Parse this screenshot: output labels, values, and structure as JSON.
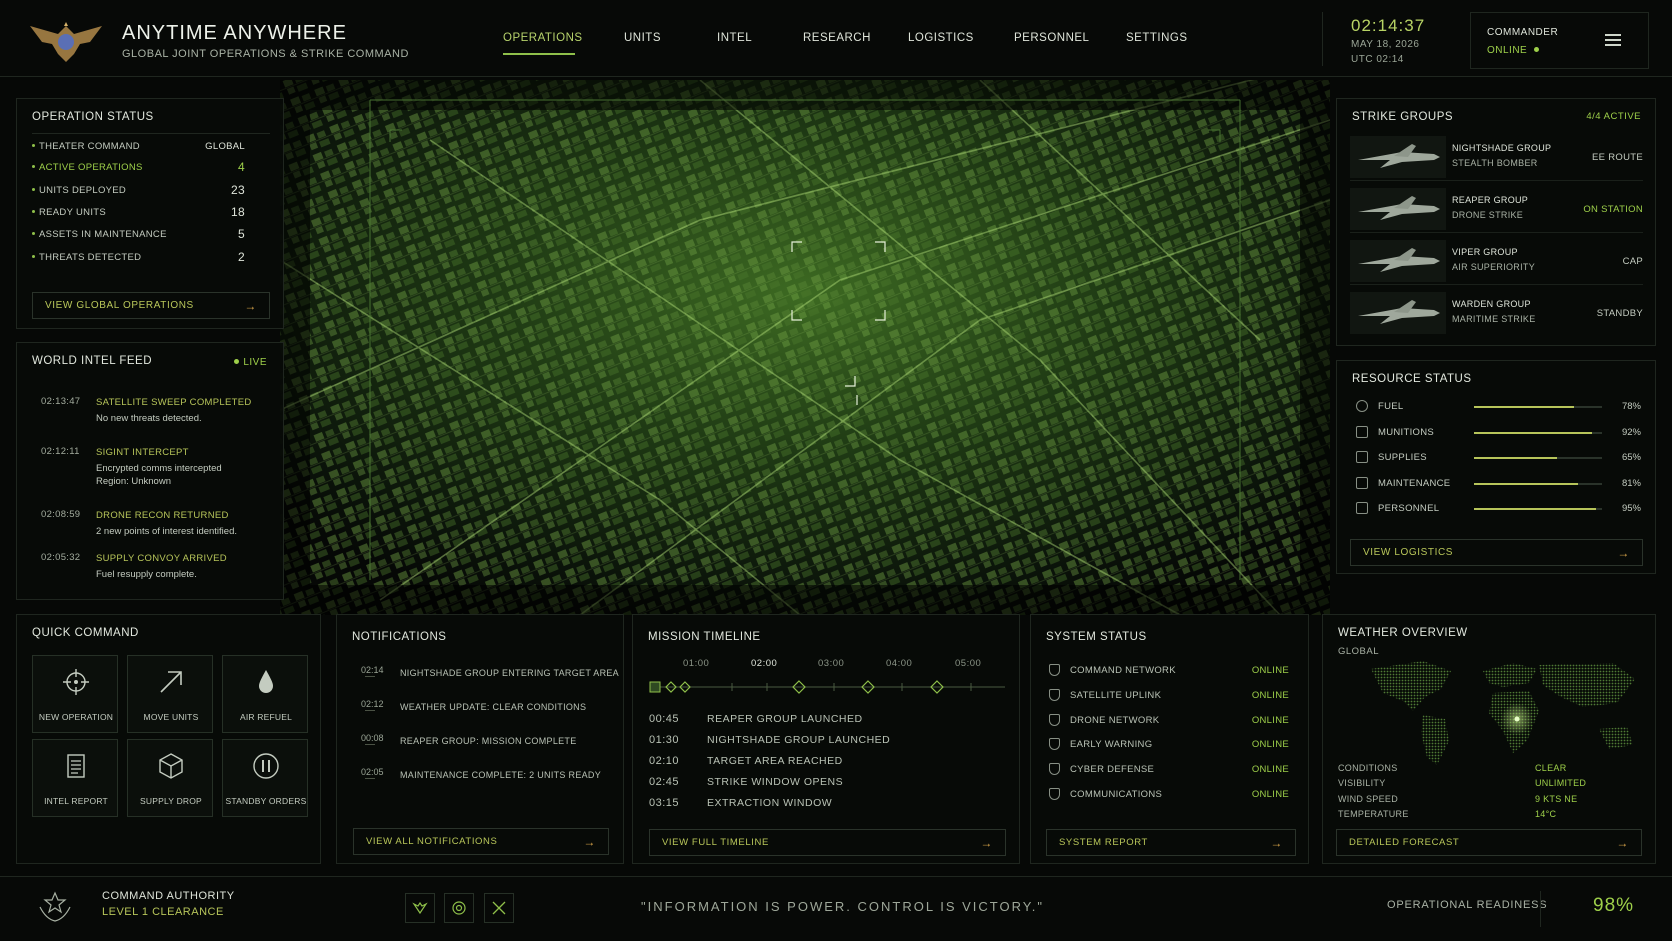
{
  "app": {
    "title": "ANYTIME ANYWHERE",
    "subtitle": "GLOBAL JOINT OPERATIONS & STRIKE COMMAND",
    "logo": "eagle-emblem"
  },
  "nav": [
    {
      "label": "OPERATIONS",
      "active": true
    },
    {
      "label": "UNITS"
    },
    {
      "label": "INTEL"
    },
    {
      "label": "RESEARCH"
    },
    {
      "label": "LOGISTICS"
    },
    {
      "label": "PERSONNEL"
    },
    {
      "label": "SETTINGS"
    }
  ],
  "clock": {
    "time": "02:14:37",
    "date": "MAY 18, 2026",
    "utc": "UTC 02:14"
  },
  "user": {
    "role": "COMMANDER",
    "status": "ONLINE",
    "menu_icon": "hamburger-icon"
  },
  "operation_status": {
    "title": "OPERATION STATUS",
    "rows": [
      {
        "label": "THEATER COMMAND",
        "value": "GLOBAL"
      },
      {
        "label": "ACTIVE OPERATIONS",
        "value": "4"
      },
      {
        "label": "UNITS DEPLOYED",
        "value": "23"
      },
      {
        "label": "READY UNITS",
        "value": "18"
      },
      {
        "label": "ASSETS IN MAINTENANCE",
        "value": "5"
      },
      {
        "label": "THREATS DETECTED",
        "value": "2"
      }
    ],
    "button": "VIEW GLOBAL OPERATIONS"
  },
  "intel_feed": {
    "title": "WORLD INTEL FEED",
    "live": "LIVE",
    "items": [
      {
        "time": "02:13:47",
        "title": "SATELLITE SWEEP COMPLETED",
        "body": "No new threats detected."
      },
      {
        "time": "02:12:11",
        "title": "SIGINT INTERCEPT",
        "body": "Encrypted comms intercepted",
        "body2": "Region: Unknown"
      },
      {
        "time": "02:08:59",
        "title": "DRONE RECON RETURNED",
        "body": "2 new points of interest identified."
      },
      {
        "time": "02:05:32",
        "title": "SUPPLY CONVOY ARRIVED",
        "body": "Fuel resupply complete."
      }
    ]
  },
  "strike_groups": {
    "title": "STRIKE GROUPS",
    "count": "4/4 ACTIVE",
    "groups": [
      {
        "name": "NIGHTSHADE GROUP",
        "type": "STEALTH BOMBER",
        "status": "EE ROUTE"
      },
      {
        "name": "REAPER GROUP",
        "type": "DRONE STRIKE",
        "status": "ON STATION"
      },
      {
        "name": "VIPER GROUP",
        "type": "AIR SUPERIORITY",
        "status": "CAP"
      },
      {
        "name": "WARDEN GROUP",
        "type": "MARITIME STRIKE",
        "status": "STANDBY"
      }
    ]
  },
  "resources": {
    "title": "RESOURCE STATUS",
    "items": [
      {
        "label": "FUEL",
        "value": "78%",
        "level": 0.78,
        "icon": "fuel-drop-icon"
      },
      {
        "label": "MUNITIONS",
        "value": "92%",
        "level": 0.92,
        "icon": "munitions-icon"
      },
      {
        "label": "SUPPLIES",
        "value": "65%",
        "level": 0.65,
        "icon": "supply-box-icon"
      },
      {
        "label": "MAINTENANCE",
        "value": "81%",
        "level": 0.81,
        "icon": "wrench-icon"
      },
      {
        "label": "PERSONNEL",
        "value": "95%",
        "level": 0.95,
        "icon": "person-icon"
      }
    ],
    "button": "VIEW LOGISTICS"
  },
  "quick_command": {
    "title": "QUICK COMMAND",
    "items": [
      {
        "label": "NEW OPERATION",
        "icon": "crosshair-icon"
      },
      {
        "label": "MOVE UNITS",
        "icon": "arrow-up-right-icon"
      },
      {
        "label": "AIR REFUEL",
        "icon": "fuel-drop-icon"
      },
      {
        "label": "INTEL REPORT",
        "icon": "document-icon"
      },
      {
        "label": "SUPPLY DROP",
        "icon": "crate-icon"
      },
      {
        "label": "STANDBY ORDERS",
        "icon": "pause-icon"
      }
    ]
  },
  "notifications": {
    "title": "NOTIFICATIONS",
    "items": [
      {
        "time": "02:14",
        "text": "NIGHTSHADE GROUP ENTERING TARGET AREA"
      },
      {
        "time": "02:12",
        "text": "WEATHER UPDATE: CLEAR CONDITIONS"
      },
      {
        "time": "00:08",
        "text": "REAPER GROUP: MISSION COMPLETE"
      },
      {
        "time": "02:05",
        "text": "MAINTENANCE COMPLETE: 2 UNITS READY"
      }
    ],
    "button": "VIEW ALL NOTIFICATIONS"
  },
  "timeline": {
    "title": "MISSION TIMELINE",
    "ticks": [
      "01:00",
      "02:00",
      "03:00",
      "04:00",
      "05:00"
    ],
    "events": [
      {
        "time": "00:45",
        "label": "REAPER GROUP LAUNCHED"
      },
      {
        "time": "01:30",
        "label": "NIGHTSHADE GROUP LAUNCHED"
      },
      {
        "time": "02:10",
        "label": "TARGET AREA REACHED"
      },
      {
        "time": "02:45",
        "label": "STRIKE WINDOW OPENS"
      },
      {
        "time": "03:15",
        "label": "EXTRACTION WINDOW"
      }
    ],
    "button": "VIEW FULL TIMELINE"
  },
  "system_status": {
    "title": "SYSTEM STATUS",
    "items": [
      {
        "label": "COMMAND NETWORK",
        "status": "ONLINE"
      },
      {
        "label": "SATELLITE UPLINK",
        "status": "ONLINE"
      },
      {
        "label": "DRONE NETWORK",
        "status": "ONLINE"
      },
      {
        "label": "EARLY WARNING",
        "status": "ONLINE"
      },
      {
        "label": "CYBER DEFENSE",
        "status": "ONLINE"
      },
      {
        "label": "COMMUNICATIONS",
        "status": "ONLINE"
      }
    ],
    "button": "SYSTEM REPORT"
  },
  "weather": {
    "title": "WEATHER OVERVIEW",
    "region": "GLOBAL",
    "rows": [
      {
        "label": "CONDITIONS",
        "value": "CLEAR"
      },
      {
        "label": "VISIBILITY",
        "value": "UNLIMITED"
      },
      {
        "label": "WIND SPEED",
        "value": "9 KTS NE"
      },
      {
        "label": "TEMPERATURE",
        "value": "14°C"
      }
    ],
    "button": "DETAILED FORECAST"
  },
  "footer": {
    "authority_title": "COMMAND AUTHORITY",
    "clearance": "LEVEL 1 CLEARANCE",
    "quote": "\"INFORMATION IS POWER. CONTROL IS VICTORY.\"",
    "readiness_label": "OPERATIONAL READINESS",
    "readiness_value": "98%"
  },
  "colors": {
    "accent": "#8fc04a",
    "gold": "#d8a44a",
    "bg": "#060806"
  }
}
